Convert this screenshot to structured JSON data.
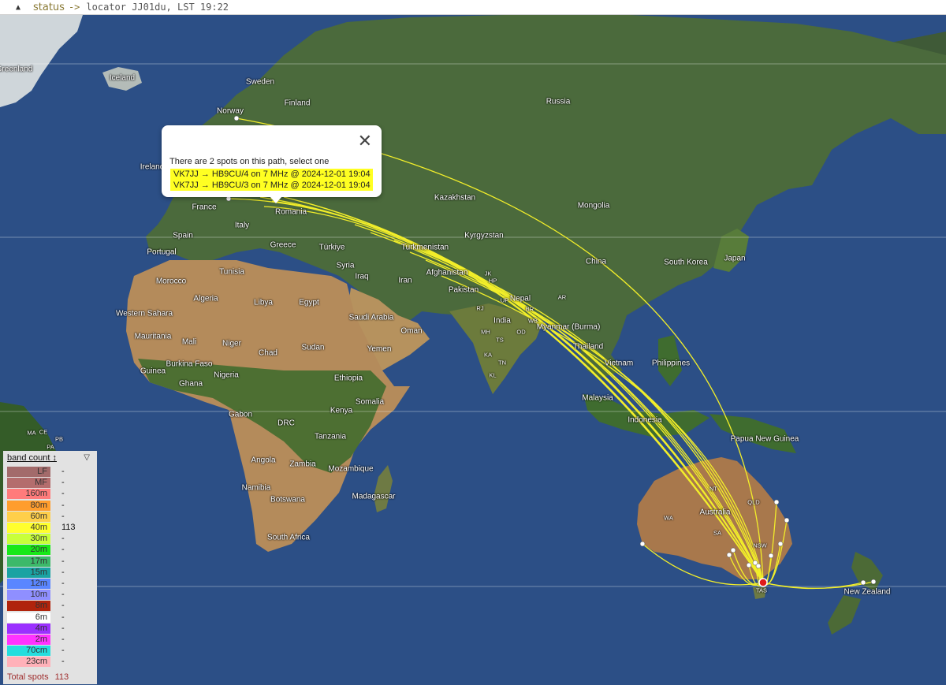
{
  "status_bar": {
    "toggle_icon": "triangle-up-icon",
    "label": "status",
    "arrow": "->",
    "locator_text": "locator JJ01du, LST 19:22"
  },
  "map": {
    "countries": [
      "Greenland",
      "Iceland",
      "Sweden",
      "Finland",
      "Norway",
      "Russia",
      "Ireland",
      "France",
      "Romania",
      "Kazakhstan",
      "Mongolia",
      "Spain",
      "Portugal",
      "Italy",
      "Greece",
      "Türkiye",
      "Kyrgyzstan",
      "Turkmenistan",
      "China",
      "South Korea",
      "Japan",
      "Tunisia",
      "Morocco",
      "Syria",
      "Iraq",
      "Iran",
      "Afghanistan",
      "Pakistan",
      "Nepal",
      "Algeria",
      "Libya",
      "Egypt",
      "Western Sahara",
      "Saudi Arabia",
      "Oman",
      "India",
      "Myanmar (Burma)",
      "Mauritania",
      "Mali",
      "Niger",
      "Chad",
      "Sudan",
      "Yemen",
      "Thailand",
      "Vietnam",
      "Philippines",
      "Guinea",
      "Burkina Faso",
      "Ghana",
      "Nigeria",
      "Ethiopia",
      "Somalia",
      "Malaysia",
      "Gabon",
      "DRC",
      "Kenya",
      "Indonesia",
      "Papua New Guinea",
      "Tanzania",
      "Angola",
      "Zambia",
      "Mozambique",
      "Namibia",
      "Botswana",
      "Madagascar",
      "Australia",
      "South Africa",
      "New Zealand"
    ],
    "region_codes": [
      "NT",
      "QLD",
      "SA",
      "NSW",
      "WA",
      "TAS",
      "HP",
      "JK",
      "UP",
      "AR",
      "BR",
      "WB",
      "OD",
      "RJ",
      "MH",
      "TS",
      "KA",
      "TN",
      "KL",
      "CE",
      "PB",
      "PA",
      "MA"
    ]
  },
  "popup": {
    "close_icon": "close-icon",
    "message": "There are 2 spots on this path, select one",
    "spots": [
      "VK7JJ → HB9CU/4 on 7 MHz @ 2024-12-01 19:04",
      "VK7JJ → HB9CU/3 on 7 MHz @ 2024-12-01 19:04"
    ],
    "highlight_color": "#ffff22"
  },
  "legend": {
    "header_label": "band count",
    "sort_icon": "sort-arrows-icon",
    "collapse_icon": "triangle-down-icon",
    "bands": [
      {
        "band": "LF",
        "count": "-",
        "color": "#a36b6b"
      },
      {
        "band": "MF",
        "count": "-",
        "color": "#b46d6d"
      },
      {
        "band": "160m",
        "count": "-",
        "color": "#ff7b7b"
      },
      {
        "band": "80m",
        "count": "-",
        "color": "#ff9d2d"
      },
      {
        "band": "60m",
        "count": "-",
        "color": "#ffcf4a"
      },
      {
        "band": "40m",
        "count": "113",
        "color": "#ffff2e"
      },
      {
        "band": "30m",
        "count": "-",
        "color": "#c8ff3a"
      },
      {
        "band": "20m",
        "count": "-",
        "color": "#18e818"
      },
      {
        "band": "17m",
        "count": "-",
        "color": "#3cb96a"
      },
      {
        "band": "15m",
        "count": "-",
        "color": "#1aa3a3"
      },
      {
        "band": "12m",
        "count": "-",
        "color": "#5a86ff"
      },
      {
        "band": "10m",
        "count": "-",
        "color": "#8f8fff"
      },
      {
        "band": "8m",
        "count": "-",
        "color": "#b0240c"
      },
      {
        "band": "6m",
        "count": "-",
        "color": "#ffffff"
      },
      {
        "band": "4m",
        "count": "-",
        "color": "#9b30ff"
      },
      {
        "band": "2m",
        "count": "-",
        "color": "#ff33ff"
      },
      {
        "band": "70cm",
        "count": "-",
        "color": "#24dede"
      },
      {
        "band": "23cm",
        "count": "-",
        "color": "#ffb1b9"
      }
    ],
    "total_label": "Total spots",
    "total_value": "113"
  },
  "colors": {
    "ocean": "#2c4f86",
    "path_line": "#f2ee2a",
    "home_marker": "#e01b1b"
  }
}
